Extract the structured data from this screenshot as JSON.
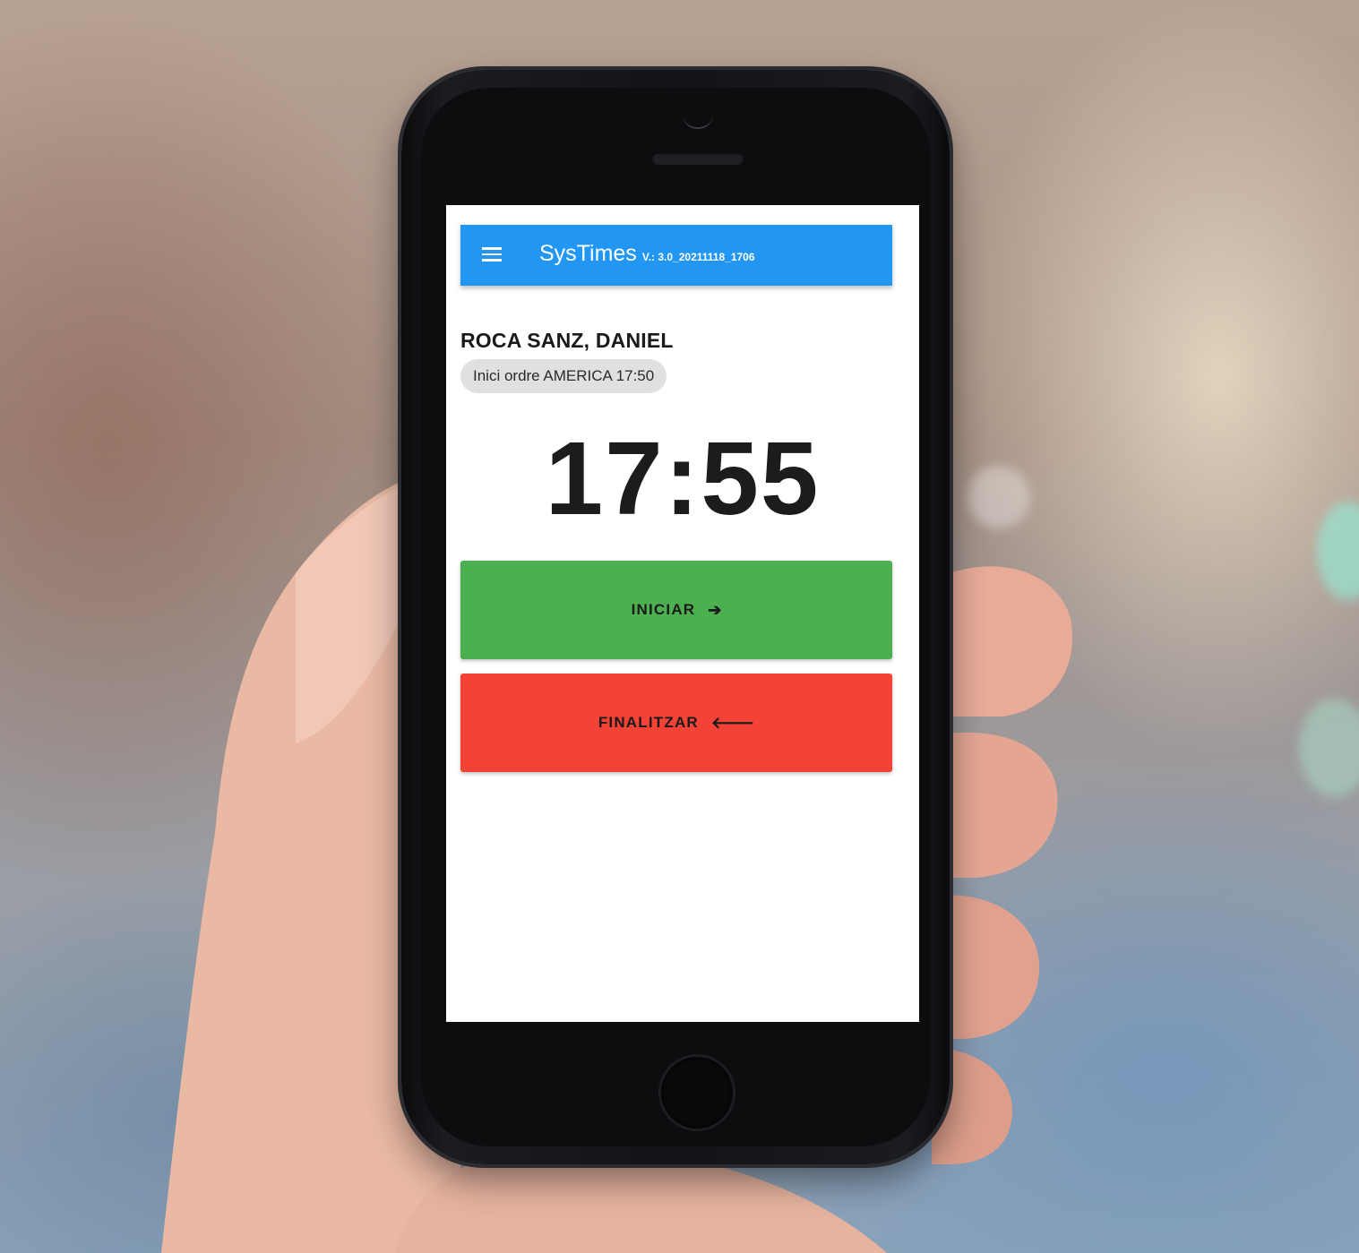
{
  "app": {
    "title": "SysTimes",
    "version": "V.: 3.0_20211118_1706",
    "accent_color": "#2196f3"
  },
  "header": {
    "menu_icon": "hamburger-menu-icon"
  },
  "user": {
    "name": "ROCA SANZ, DANIEL"
  },
  "order_status": {
    "text": "Inici ordre AMERICA 17:50"
  },
  "clock": {
    "time": "17:55"
  },
  "actions": {
    "start": {
      "label": "INICIAR",
      "icon": "arrow-right-icon",
      "color": "#4caf50"
    },
    "end": {
      "label": "FINALITZAR",
      "icon": "arrow-left-icon",
      "color": "#f44336"
    }
  }
}
